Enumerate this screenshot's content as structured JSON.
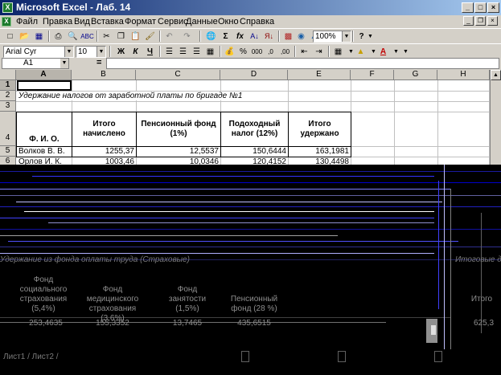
{
  "window": {
    "title": "Microsoft Excel - Лаб. 14",
    "icon_label": "X",
    "controls": {
      "minimize": "_",
      "maximize": "□",
      "close": "×"
    },
    "doc_controls": {
      "minimize": "_",
      "restore": "❐",
      "close": "×"
    }
  },
  "menu": {
    "items": [
      "Файл",
      "Правка",
      "Вид",
      "Вставка",
      "Формат",
      "Сервис",
      "Данные",
      "Окно",
      "Справка"
    ]
  },
  "toolbar_standard": {
    "icons": [
      "new-icon",
      "open-icon",
      "save-icon",
      "print-icon",
      "print-preview-icon",
      "spelling-icon",
      "cut-icon",
      "copy-icon",
      "paste-icon",
      "format-painter-icon",
      "undo-icon",
      "redo-icon",
      "hyperlink-icon",
      "autosum-icon",
      "function-icon",
      "sort-asc-icon",
      "sort-desc-icon",
      "chart-wizard-icon",
      "map-icon",
      "drawing-icon",
      "help-icon"
    ],
    "zoom": "100%",
    "glyphs": {
      "autosum": "Σ",
      "function": "fx",
      "help": "?"
    }
  },
  "toolbar_formatting": {
    "font": "Arial Cyr",
    "size": "10",
    "bold": "Ж",
    "italic": "К",
    "underline": "Ч",
    "currency": "%",
    "thousands": "000",
    "increase_decimal": ",0",
    "decrease_decimal": ",00"
  },
  "formula_bar": {
    "name_box": "A1",
    "equals": "=",
    "content": ""
  },
  "columns": [
    "A",
    "B",
    "C",
    "D",
    "E",
    "F",
    "G",
    "H"
  ],
  "rows": [
    "1",
    "2",
    "3",
    "4",
    "5",
    "6"
  ],
  "sheet": {
    "title_row": "Удержание налогов от заработной платы по бригаде №1",
    "headers": {
      "a": "Ф. И. О.",
      "b": "Итого начислено",
      "c": "Пенсионный фонд (1%)",
      "d": "Подоходный налог (12%)",
      "e": "Итого удержано"
    },
    "row5": {
      "name": "Волков В. В.",
      "b": "1255,37",
      "c": "12,5537",
      "d": "150,6444",
      "e": "163,1981"
    },
    "row6": {
      "name": "Орлов И. К.",
      "b": "1003,46",
      "c": "10,0346",
      "d": "120,4152",
      "e": "130,4498"
    }
  },
  "ghost_text": {
    "title": "Удержание из фонда оплаты труда (Страховые)",
    "right_note": "Итоговые д",
    "headers": [
      "Фонд социального страхования (5,4%)",
      "Фонд медицинского страхования (3,6%)",
      "Фонд занятости (1,5%)",
      "Пенсионный фонд (28 %)",
      "Итого"
    ],
    "values": [
      "253,4635",
      "155,3352",
      "13,7465",
      "435,6515",
      "625,3"
    ],
    "sheet_tabs": "Лист1 / Лист2 /"
  }
}
